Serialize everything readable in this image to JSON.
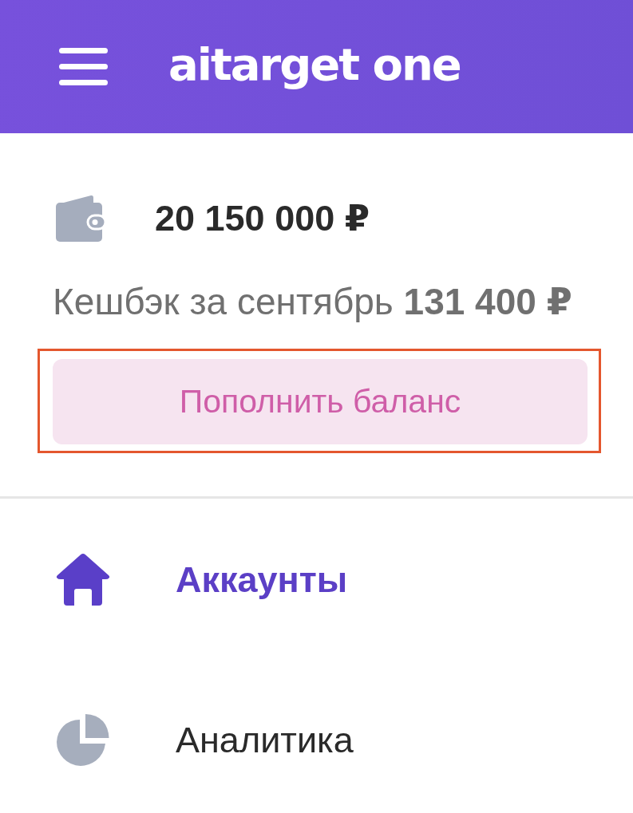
{
  "header": {
    "logo": "aitarget one"
  },
  "balance": {
    "amount": "20 150 000 ₽",
    "cashback": "Кешбэк за сентябрь **131 400 ₽**"
  },
  "topup_button": {
    "label": "Пополнить баланс",
    "highlighted": true
  },
  "menu": [
    {
      "label": "Аккаунты",
      "selected": true
    },
    {
      "label": "Аналитика",
      "selected": false
    }
  ]
}
